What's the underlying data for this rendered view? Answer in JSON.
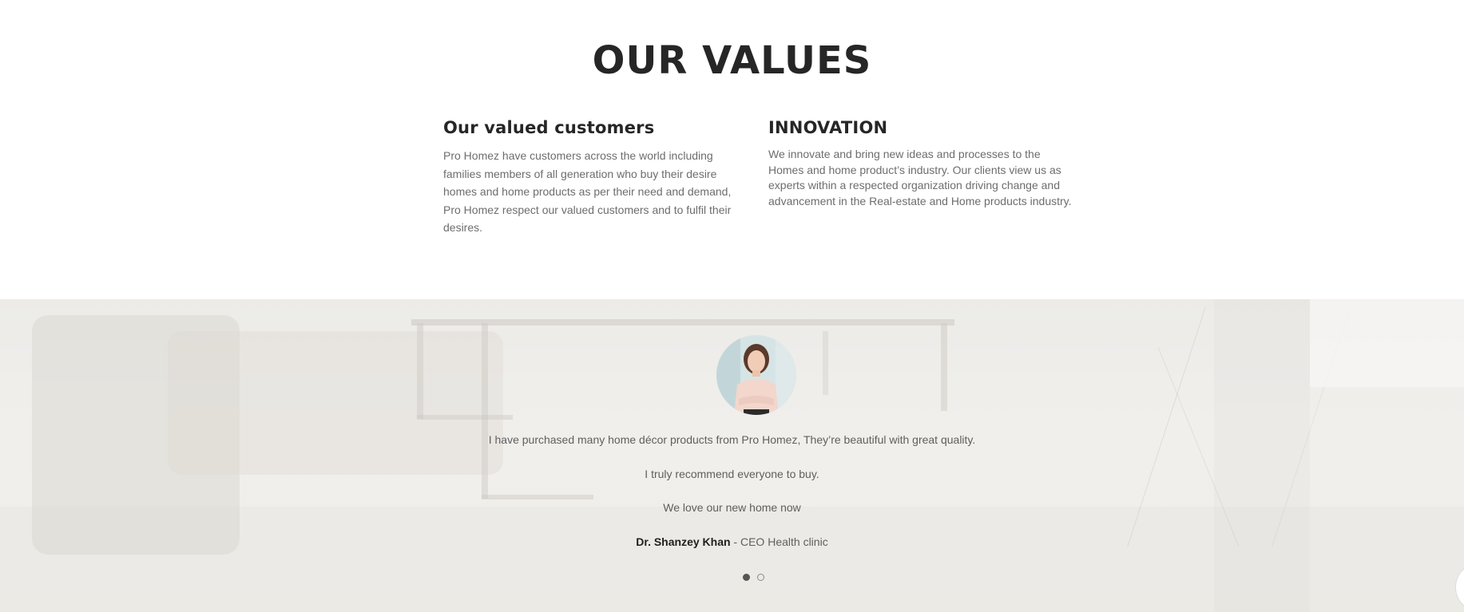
{
  "values": {
    "title": "OUR VALUES",
    "columns": [
      {
        "heading": "Our valued customers",
        "text": "Pro Homez have customers across the world including families members of all generation who buy their desire homes and home products as per their need and demand, Pro Homez respect our valued customers and to fulfil their desires."
      },
      {
        "heading": "INNOVATION",
        "text": "We innovate and bring new ideas and processes to the Homes and home product’s industry. Our clients view us as experts within a respected organization driving change and advancement in the Real-estate and Home products industry."
      }
    ]
  },
  "testimonial": {
    "quote_lines": [
      "I have purchased many home décor products from Pro Homez, They’re beautiful with great quality.",
      "I truly recommend everyone to buy.",
      "We love our new home now"
    ],
    "author_name": "Dr. Shanzey Khan",
    "author_role": " - CEO Health clinic",
    "slides": [
      {
        "active": true
      },
      {
        "active": false
      }
    ]
  },
  "colors": {
    "heading": "#262626",
    "body_text": "#6d6d6d",
    "testimonial_bg": "#efeeea"
  },
  "icons": [
    "avatar-photo"
  ]
}
